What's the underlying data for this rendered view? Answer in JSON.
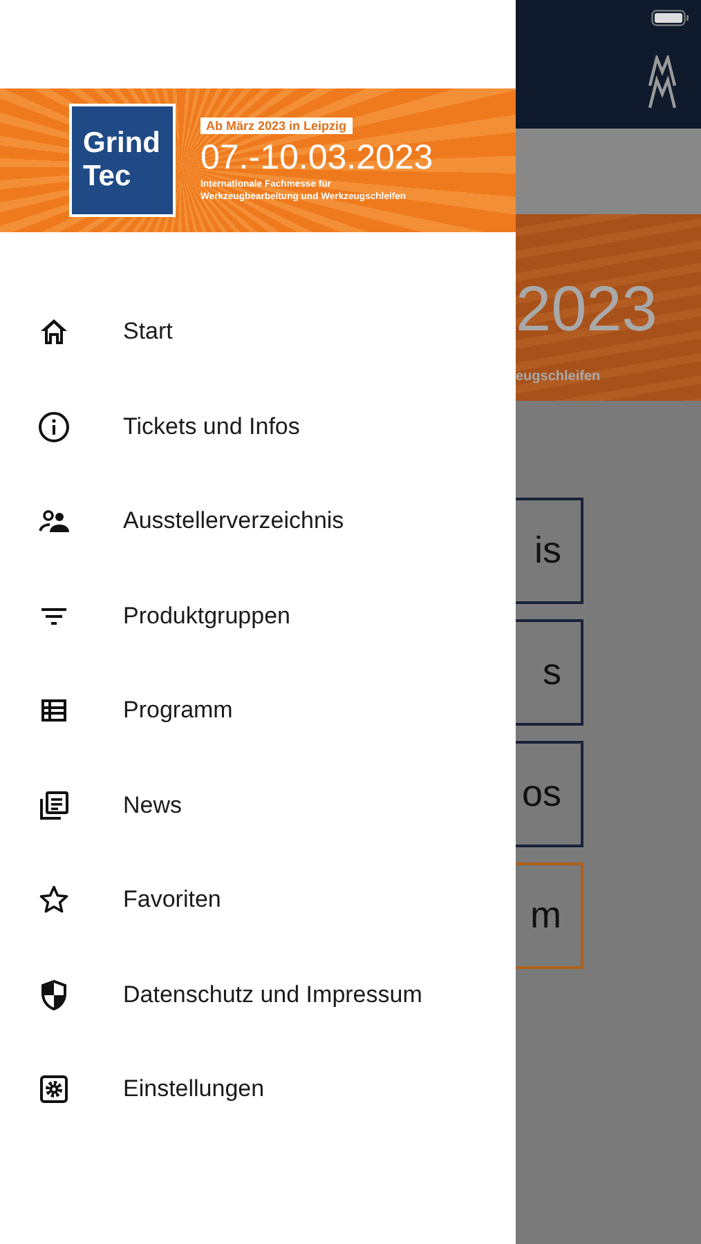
{
  "banner": {
    "logo_lines": [
      "Grind",
      "Tec"
    ],
    "badge": "Ab März 2023 in Leipzig",
    "dates": "07.-10.03.2023",
    "subtitle_lines": [
      "Internationale Fachmesse für",
      "Werkzeugbearbeitung und Werkzeugschleifen"
    ]
  },
  "menu": [
    {
      "label": "Start"
    },
    {
      "label": "Tickets und Infos"
    },
    {
      "label": "Ausstellerverzeichnis"
    },
    {
      "label": "Produktgruppen"
    },
    {
      "label": "Programm"
    },
    {
      "label": "News"
    },
    {
      "label": "Favoriten"
    },
    {
      "label": "Datenschutz und Impressum"
    },
    {
      "label": "Einstellungen"
    }
  ],
  "background": {
    "banner_dates": "2023",
    "banner_subtitle": "eugschleifen",
    "buttons": [
      {
        "label": "is",
        "color": "#17233a"
      },
      {
        "label": "s",
        "color": "#17233a"
      },
      {
        "label": "os",
        "color": "#17233a"
      },
      {
        "label": "m",
        "color": "#b0601a"
      }
    ]
  }
}
